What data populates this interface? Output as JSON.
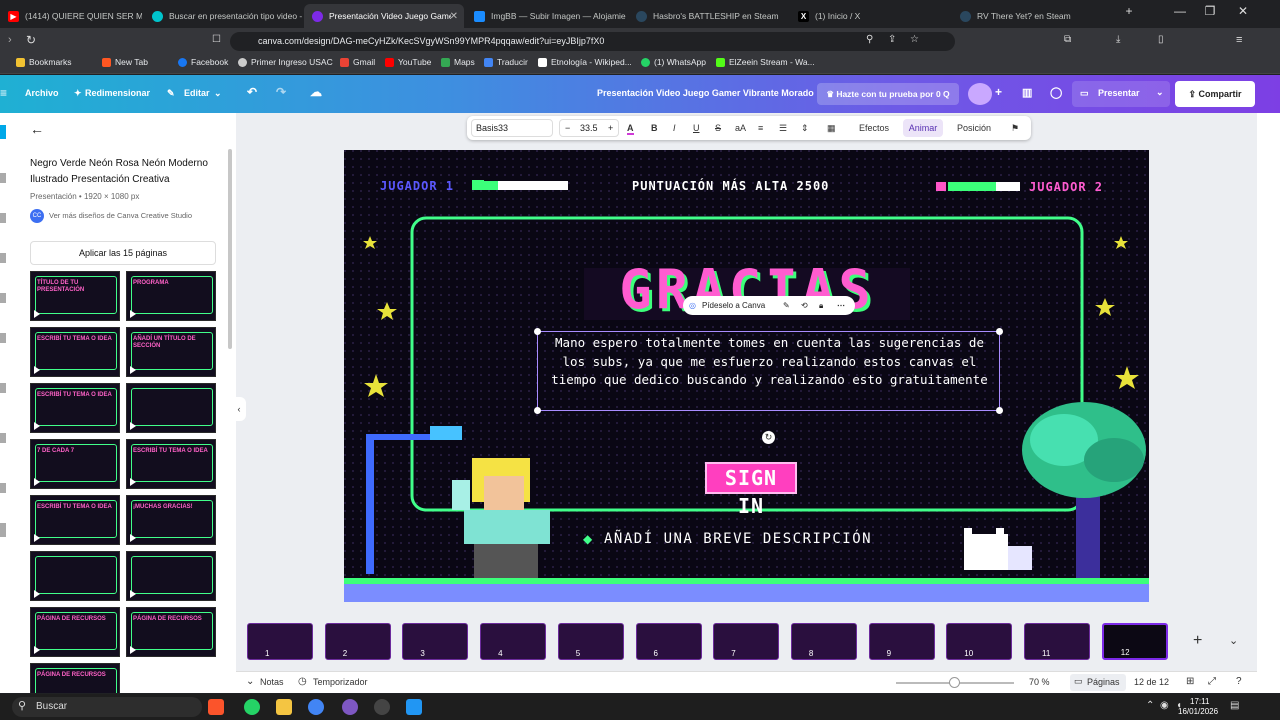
{
  "browser": {
    "tabs": [
      {
        "label": "(1414) QUIERE QUIEN SER MILLONARIO",
        "color": "#ff0000",
        "icon": "youtube-icon"
      },
      {
        "label": "Buscar en presentación tipo video -",
        "color": "#00c4cc",
        "icon": "canva-icon"
      },
      {
        "label": "Presentación Video Juego Gamer",
        "color": "#7d2ae8",
        "icon": "canva-icon"
      },
      {
        "label": "ImgBB — Subir Imagen — Alojamiento",
        "color": "#1a8cff",
        "icon": "imgbb-icon"
      },
      {
        "label": "Hasbro's BATTLESHIP en Steam",
        "color": "#1b2838",
        "icon": "steam-icon"
      },
      {
        "label": "(1) Inicio / X",
        "color": "#000000",
        "icon": "x-icon"
      },
      {
        "label": "RV There Yet? en Steam",
        "color": "#1b2838",
        "icon": "steam-icon"
      }
    ],
    "url": "canva.com/design/DAG-meCyHZk/KecSVgyWSn99YMPR4pqqaw/edit?ui=eyJBIjp7fX0",
    "bookmarks": [
      {
        "label": "Bookmarks",
        "color": "#f1c232"
      },
      {
        "label": "New Tab",
        "color": "#ff5722"
      },
      {
        "label": "Facebook",
        "color": "#1877f2"
      },
      {
        "label": "Primer Ingreso USAC",
        "color": "#cccccc"
      },
      {
        "label": "Gmail",
        "color": "#ea4335"
      },
      {
        "label": "YouTube",
        "color": "#ff0000"
      },
      {
        "label": "Maps",
        "color": "#34a853"
      },
      {
        "label": "Traducir",
        "color": "#4285f4"
      },
      {
        "label": "Etnología - Wikiped...",
        "color": "#ffffff"
      },
      {
        "label": "(1) WhatsApp",
        "color": "#25d366"
      },
      {
        "label": "ElZeein Stream - Wa...",
        "color": "#53fc18"
      }
    ]
  },
  "canva": {
    "menu": {
      "archivo": "Archivo",
      "redimensionar": "Redimensionar",
      "editar": "Editar"
    },
    "doc_title": "Presentación Video Juego Gamer Vibrante Morado",
    "try_free": "Hazte con tu prueba por 0 Q",
    "presentar": "Presentar",
    "compartir": "Compartir",
    "toolbar": {
      "font": "Basis33",
      "size": "33.5",
      "efectos": "Efectos",
      "animar": "Animar",
      "posicion": "Posición"
    },
    "left_panel": {
      "title": "Negro Verde Neón Rosa Neón Moderno Ilustrado Presentación Creativa",
      "meta": "Presentación • 1920 × 1080 px",
      "author": "Ver más diseños de Canva Creative Studio",
      "apply_button": "Aplicar las 15 páginas",
      "thumbs": [
        "TÍTULO DE TU PRESENTACIÓN",
        "PROGRAMA",
        "ESCRIBÍ TU TEMA O IDEA",
        "AÑADÍ UN TÍTULO DE SECCIÓN",
        "ESCRIBÍ TU TEMA O IDEA",
        "",
        "7 DE CADA 7",
        "ESCRIBÍ TU TEMA O IDEA",
        "ESCRIBÍ TU TEMA O IDEA",
        "¡MUCHAS GRACIAS!",
        "",
        "",
        "PÁGINA DE RECURSOS",
        "PÁGINA DE RECURSOS",
        "PÁGINA DE RECURSOS"
      ]
    },
    "slide": {
      "player1": "JUGADOR 1",
      "player2": "JUGADOR 2",
      "highscore": "PUNTUACIÓN MÁS ALTA 2500",
      "title": "GRACIAS",
      "body": "Mano espero totalmente tomes en cuenta las sugerencias de los subs, ya que me esfuerzo realizando estos canvas el tiempo que dedico buscando y realizando esto gratuitamente",
      "sign_in": "SIGN IN",
      "description": "AÑADÍ UNA BREVE DESCRIPCIÓN",
      "ask_canva": "Pídeselo a Canva"
    },
    "pages": [
      "1",
      "2",
      "3",
      "4",
      "5",
      "6",
      "7",
      "8",
      "9",
      "10",
      "11",
      "12"
    ],
    "status": {
      "notas": "Notas",
      "temporizador": "Temporizador",
      "zoom": "70 %",
      "paginas": "Páginas",
      "page_count": "12 de 12"
    }
  },
  "taskbar": {
    "search": "Buscar",
    "time": "17:11",
    "date": "16/01/2026"
  }
}
